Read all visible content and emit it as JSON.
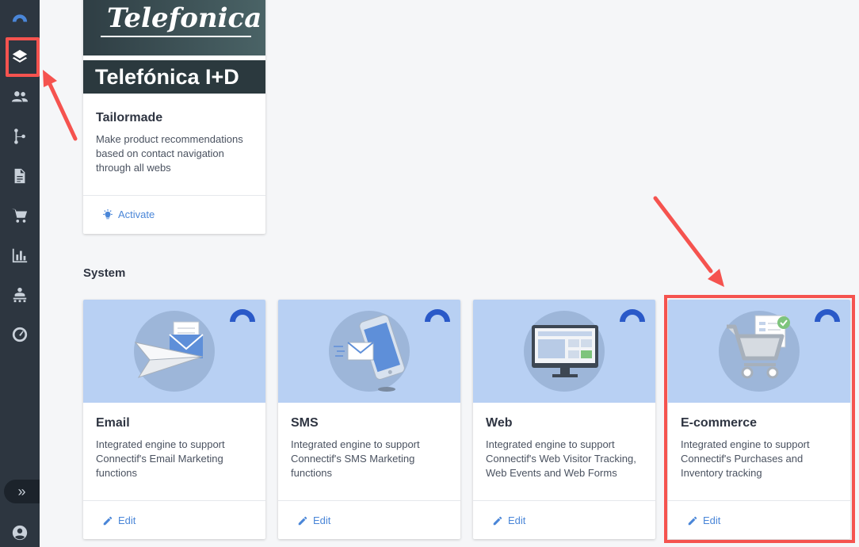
{
  "sidebar": {
    "items": [
      {
        "name": "logo-arc-icon"
      },
      {
        "name": "layers-icon"
      },
      {
        "name": "people-icon"
      },
      {
        "name": "flow-icon"
      },
      {
        "name": "document-icon"
      },
      {
        "name": "cart-icon"
      },
      {
        "name": "bar-chart-icon"
      },
      {
        "name": "org-icon"
      },
      {
        "name": "gauge-icon"
      }
    ],
    "expand_label": "»"
  },
  "tailormade": {
    "logo_top_text": "Telefonica",
    "logo_bottom_text": "Telefónica I+D",
    "title": "Tailormade",
    "description": "Make product recommendations based on contact navigation through all webs",
    "action_label": "Activate"
  },
  "section": {
    "title": "System"
  },
  "system_cards": [
    {
      "title": "Email",
      "description": "Integrated engine to support Connectif's Email Marketing functions",
      "action_label": "Edit"
    },
    {
      "title": "SMS",
      "description": "Integrated engine to support Connectif's SMS Marketing functions",
      "action_label": "Edit"
    },
    {
      "title": "Web",
      "description": "Integrated engine to support Connectif's Web Visitor Tracking, Web Events and Web Forms",
      "action_label": "Edit"
    },
    {
      "title": "E-commerce",
      "description": "Integrated engine to support Connectif's Purchases and Inventory tracking",
      "action_label": "Edit"
    }
  ],
  "colors": {
    "accent": "#4a86d8",
    "highlight": "#f5534f",
    "sidebar": "#2d3640",
    "card_header": "#b8d0f3"
  }
}
